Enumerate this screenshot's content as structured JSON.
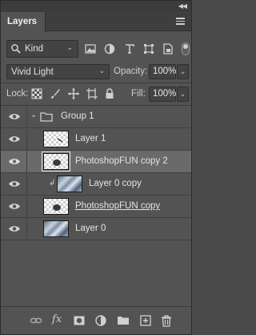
{
  "panel": {
    "tab_label": "Layers"
  },
  "filter": {
    "kind_label": "Kind"
  },
  "blend": {
    "mode": "Vivid Light",
    "opacity_label": "Opacity:",
    "opacity_value": "100%"
  },
  "lock": {
    "label": "Lock:",
    "fill_label": "Fill:",
    "fill_value": "100%"
  },
  "layers": [
    {
      "name": "Group 1",
      "type": "group"
    },
    {
      "name": "Layer 1"
    },
    {
      "name": "PhotoshopFUN copy 2",
      "selected": true
    },
    {
      "name": "Layer 0 copy",
      "clipped": true
    },
    {
      "name": "PhotoshopFUN copy"
    },
    {
      "name": "Layer 0"
    }
  ],
  "colors": {
    "panel_bg": "#535353",
    "selected_row": "#6a6a6a",
    "text": "#e4e4e4"
  }
}
